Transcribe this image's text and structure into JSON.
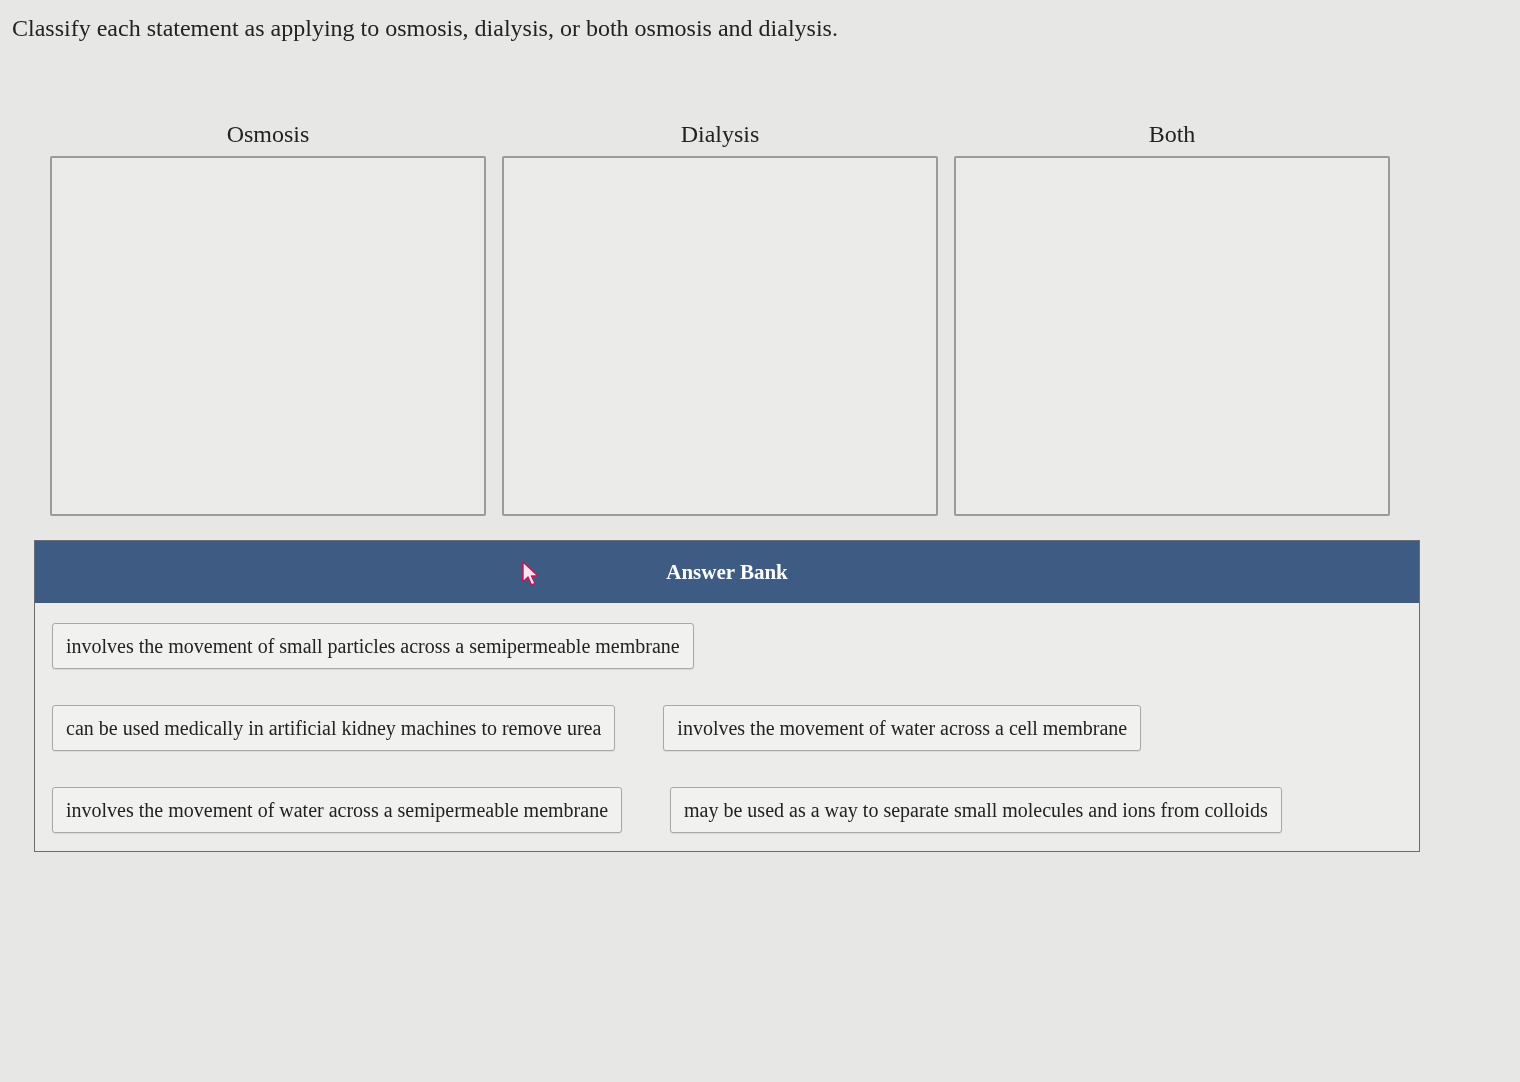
{
  "instruction": "Classify each statement as applying to osmosis, dialysis, or both osmosis and dialysis.",
  "categories": [
    {
      "label": "Osmosis"
    },
    {
      "label": "Dialysis"
    },
    {
      "label": "Both"
    }
  ],
  "answer_bank": {
    "title": "Answer Bank",
    "rows": [
      {
        "items": [
          "involves the movement of small particles across a semipermeable membrane"
        ]
      },
      {
        "items": [
          "can be used medically in artificial kidney machines to remove urea",
          "involves the movement of water across a cell membrane"
        ]
      },
      {
        "items": [
          "involves the movement of water across a semipermeable membrane",
          "may be used as a way to separate small molecules and ions from colloids"
        ]
      }
    ]
  }
}
